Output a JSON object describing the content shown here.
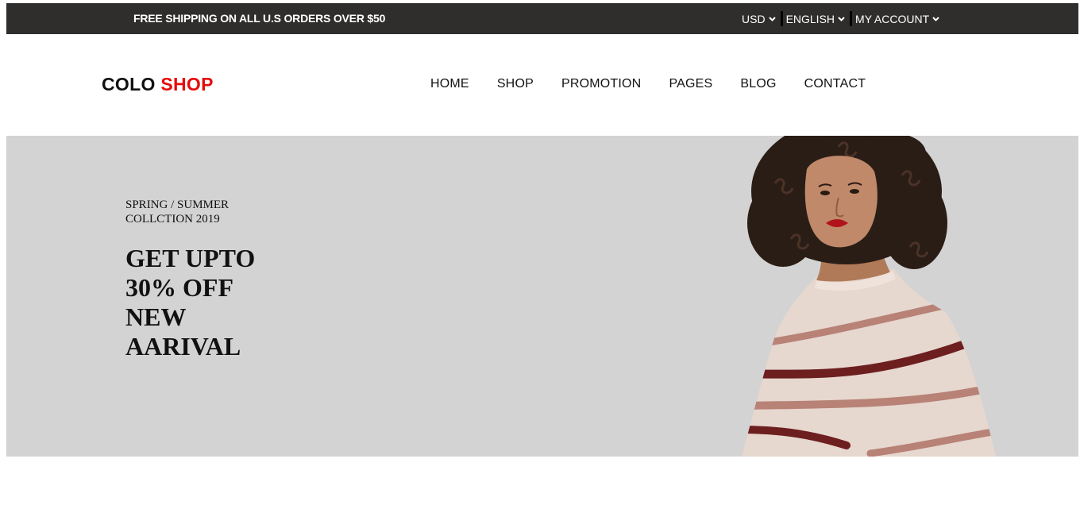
{
  "topbar": {
    "shipping_text": "FREE SHIPPING ON ALL U.S ORDERS OVER $50",
    "currency": "USD",
    "language": "ENGLISH",
    "account": "MY ACCOUNT",
    "background_color": "#302e2c"
  },
  "header": {
    "logo_part1": "COLO",
    "logo_part2": "SHOP",
    "logo_accent_color": "#e60b0b",
    "nav": [
      "HOME",
      "SHOP",
      "PROMOTION",
      "PAGES",
      "BLOG",
      "CONTACT"
    ]
  },
  "hero": {
    "subtitle": "SPRING / SUMMER COLLCTION 2019",
    "title": "GET UPTO 30% OFF NEW AARIVAL",
    "background_color": "#d3d3d3",
    "image_icon": "model-photo"
  }
}
